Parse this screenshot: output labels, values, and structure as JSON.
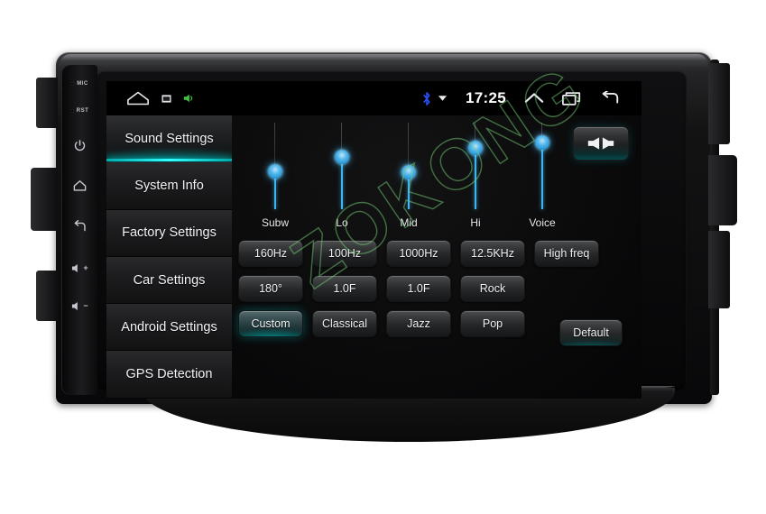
{
  "device": {
    "side_controls": [
      {
        "name": "mic",
        "label": "MIC",
        "type": "pinhole-label"
      },
      {
        "name": "reset",
        "label": "RST",
        "type": "pinhole-label"
      },
      {
        "name": "power",
        "label": "",
        "type": "power-icon"
      },
      {
        "name": "home",
        "label": "",
        "type": "home-icon"
      },
      {
        "name": "back",
        "label": "",
        "type": "back-icon"
      },
      {
        "name": "volume-up",
        "label": "+",
        "type": "volume-up-icon"
      },
      {
        "name": "volume-down",
        "label": "−",
        "type": "volume-down-icon"
      }
    ]
  },
  "statusbar": {
    "time": "17:25",
    "left_icons": [
      "home-icon",
      "screenshot-icon",
      "volume-icon"
    ],
    "right_icons": [
      "bluetooth-icon",
      "dropdown-triangle-icon",
      "chevron-up-icon",
      "recent-apps-icon",
      "back-arrow-icon"
    ]
  },
  "sidebar": {
    "items": [
      {
        "label": "Sound Settings",
        "selected": true
      },
      {
        "label": "System Info",
        "selected": false
      },
      {
        "label": "Factory Settings",
        "selected": false
      },
      {
        "label": "Car Settings",
        "selected": false
      },
      {
        "label": "Android Settings",
        "selected": false
      },
      {
        "label": "GPS Detection",
        "selected": false
      }
    ]
  },
  "equalizer": {
    "sliders": [
      {
        "label": "Subw",
        "value": 52
      },
      {
        "label": "Lo",
        "value": 68
      },
      {
        "label": "Mid",
        "value": 51
      },
      {
        "label": "Hi",
        "value": 78
      },
      {
        "label": "Voice",
        "value": 84
      }
    ],
    "balance_button": {
      "icon": "balance-fader-icon"
    }
  },
  "buttons": {
    "row1": [
      {
        "label": "160Hz",
        "active": false
      },
      {
        "label": "100Hz",
        "active": false
      },
      {
        "label": "1000Hz",
        "active": false
      },
      {
        "label": "12.5KHz",
        "active": false
      },
      {
        "label": "High freq",
        "active": false
      }
    ],
    "row2": [
      {
        "label": "180°",
        "active": false
      },
      {
        "label": "1.0F",
        "active": false
      },
      {
        "label": "1.0F",
        "active": false
      },
      {
        "label": "Rock",
        "active": false
      }
    ],
    "row3": [
      {
        "label": "Custom",
        "active": true
      },
      {
        "label": "Classical",
        "active": false
      },
      {
        "label": "Jazz",
        "active": false
      },
      {
        "label": "Pop",
        "active": false
      }
    ],
    "default_label": "Default"
  },
  "watermark": {
    "text": "ZOKONG",
    "color": "#78d278"
  }
}
